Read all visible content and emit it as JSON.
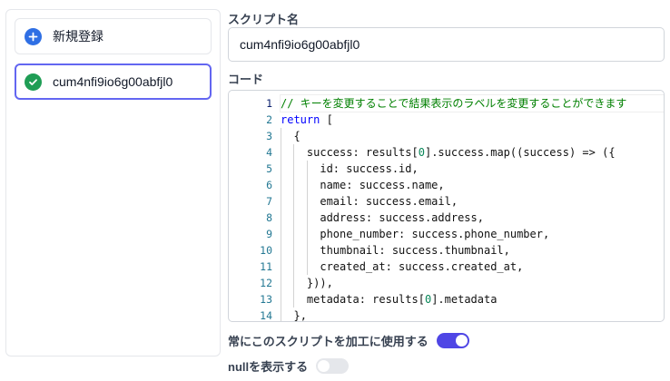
{
  "sidebar": {
    "new_label": "新規登録",
    "items": [
      {
        "label": "cum4nfi9io6g00abfjl0",
        "selected": true
      }
    ]
  },
  "form": {
    "name_label": "スクリプト名",
    "name_value": "cum4nfi9io6g00abfjl0",
    "code_label": "コード"
  },
  "code": {
    "line_numbers": [
      "1",
      "2",
      "3",
      "4",
      "5",
      "6",
      "7",
      "8",
      "9",
      "10",
      "11",
      "12",
      "13",
      "14"
    ],
    "current_line": 1,
    "lines": [
      "// キーを変更することで結果表示のラベルを変更することができます",
      "return [",
      "  {",
      "    success: results[0].success.map((success) => ({",
      "      id: success.id,",
      "      name: success.name,",
      "      email: success.email,",
      "      address: success.address,",
      "      phone_number: success.phone_number,",
      "      thumbnail: success.thumbnail,",
      "      created_at: success.created_at,",
      "    })),",
      "    metadata: results[0].metadata",
      "  },"
    ]
  },
  "toggles": {
    "always_use_label": "常にこのスクリプトを加工に使用する",
    "always_use_on": true,
    "show_null_label": "nullを表示する",
    "show_null_on": false
  },
  "colors": {
    "accent": "#4f46e5",
    "selected_border": "#6366f1",
    "plus_icon": "#2f6fe4",
    "check_icon": "#1f9d55",
    "comment": "#008000",
    "keyword": "#0000ff",
    "line_number": "#237893"
  }
}
